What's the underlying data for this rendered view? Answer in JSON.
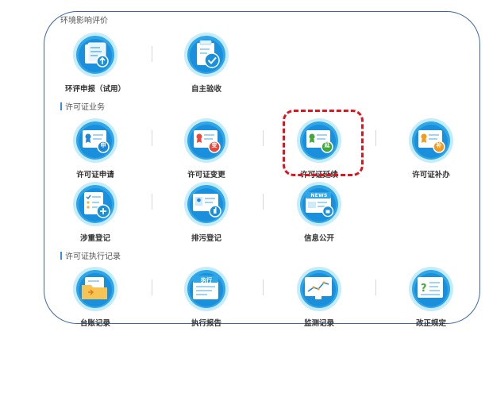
{
  "sections": {
    "env": {
      "title": "环境影响评价"
    },
    "permit": {
      "title": "许可证业务"
    },
    "exec": {
      "title": "许可证执行记录"
    }
  },
  "tiles": {
    "eia_report": {
      "label": "环评申报（试用）",
      "icon": "upload-document-icon"
    },
    "self_acceptance": {
      "label": "自主验收",
      "icon": "checkmark-clipboard-icon"
    },
    "permit_apply": {
      "label": "许可证申请",
      "icon": "certificate-apply-icon",
      "badge": "申"
    },
    "permit_change": {
      "label": "许可证变更",
      "icon": "certificate-change-icon",
      "badge": "变"
    },
    "permit_extend": {
      "label": "许可证延续",
      "icon": "certificate-extend-icon",
      "badge": "延"
    },
    "permit_reissue": {
      "label": "许可证补办",
      "icon": "certificate-reissue-icon",
      "badge": "补"
    },
    "involve_register": {
      "label": "涉重登记",
      "icon": "checklist-add-icon"
    },
    "discharge_register": {
      "label": "排污登记",
      "icon": "id-card-hand-icon"
    },
    "info_public": {
      "label": "信息公开",
      "icon": "news-icon",
      "news_text": "NEWS"
    },
    "ledger_record": {
      "label": "台账记录",
      "icon": "folder-icon"
    },
    "exec_report": {
      "label": "执行报告",
      "icon": "report-icon",
      "header_text": "执行"
    },
    "monitor_record": {
      "label": "监测记录",
      "icon": "line-chart-icon"
    },
    "rectify_rules": {
      "label": "改正规定",
      "icon": "question-document-icon"
    }
  },
  "colors": {
    "frame_border": "#3b67a8",
    "icon_outer": "#c5ecfb",
    "icon_ring": "#2fa6e8",
    "icon_inner": "#1a8fdc",
    "highlight_dash": "#e0141e",
    "badge_apply": "#1d86d8",
    "badge_change": "#e8493a",
    "badge_extend": "#43a83a",
    "badge_reissue": "#f29b1d"
  }
}
